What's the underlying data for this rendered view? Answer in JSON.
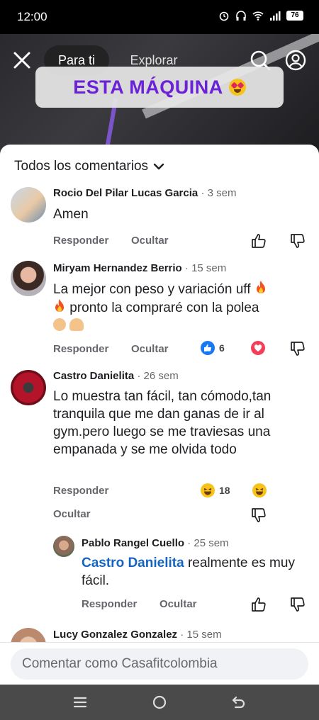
{
  "status_bar": {
    "time": "12:00",
    "battery": "76"
  },
  "top_bar": {
    "tabs": [
      {
        "label": "Para ti"
      },
      {
        "label": "Explorar"
      }
    ]
  },
  "video": {
    "banner_text": "ESTA MÁQUINA",
    "banner_emoji": "heart-eyes-emoji"
  },
  "comments_sheet": {
    "filter_label": "Todos los comentarios",
    "comments": [
      {
        "author": "Rocio Del Pilar Lucas Garcia",
        "time": "· 3 sem",
        "text": "Amen",
        "reply_label": "Responder",
        "hide_label": "Ocultar"
      },
      {
        "author": "Miryam Hernandez Berrio",
        "time": "· 15 sem",
        "text_line1": "La mejor con peso y variación uff",
        "text_line2": "pronto la compraré con la polea",
        "reply_label": "Responder",
        "hide_label": "Ocultar",
        "like_count": "6"
      },
      {
        "author": "Castro Danielita",
        "time": "· 26 sem",
        "text": "Lo muestra tan fácil, tan cómodo,tan tranquila que me dan ganas de ir al gym.pero luego se me traviesas una empanada y se me olvida todo",
        "reply_label": "Responder",
        "hide_label": "Ocultar",
        "haha_count": "18"
      },
      {
        "author": "Pablo Rangel Cuello",
        "time": "· 25 sem",
        "mention": "Castro Danielita",
        "text": "realmente es muy fácil.",
        "reply_label": "Responder",
        "hide_label": "Ocultar"
      },
      {
        "author": "Lucy Gonzalez Gonzalez",
        "time": "· 15 sem"
      }
    ]
  },
  "comment_input": {
    "placeholder": "Comentar como Casafitcolombia"
  },
  "colors": {
    "accent": "#6b21d8",
    "mention": "#1565c0",
    "like_blue": "#1877f2",
    "love_red": "#f33e58"
  }
}
